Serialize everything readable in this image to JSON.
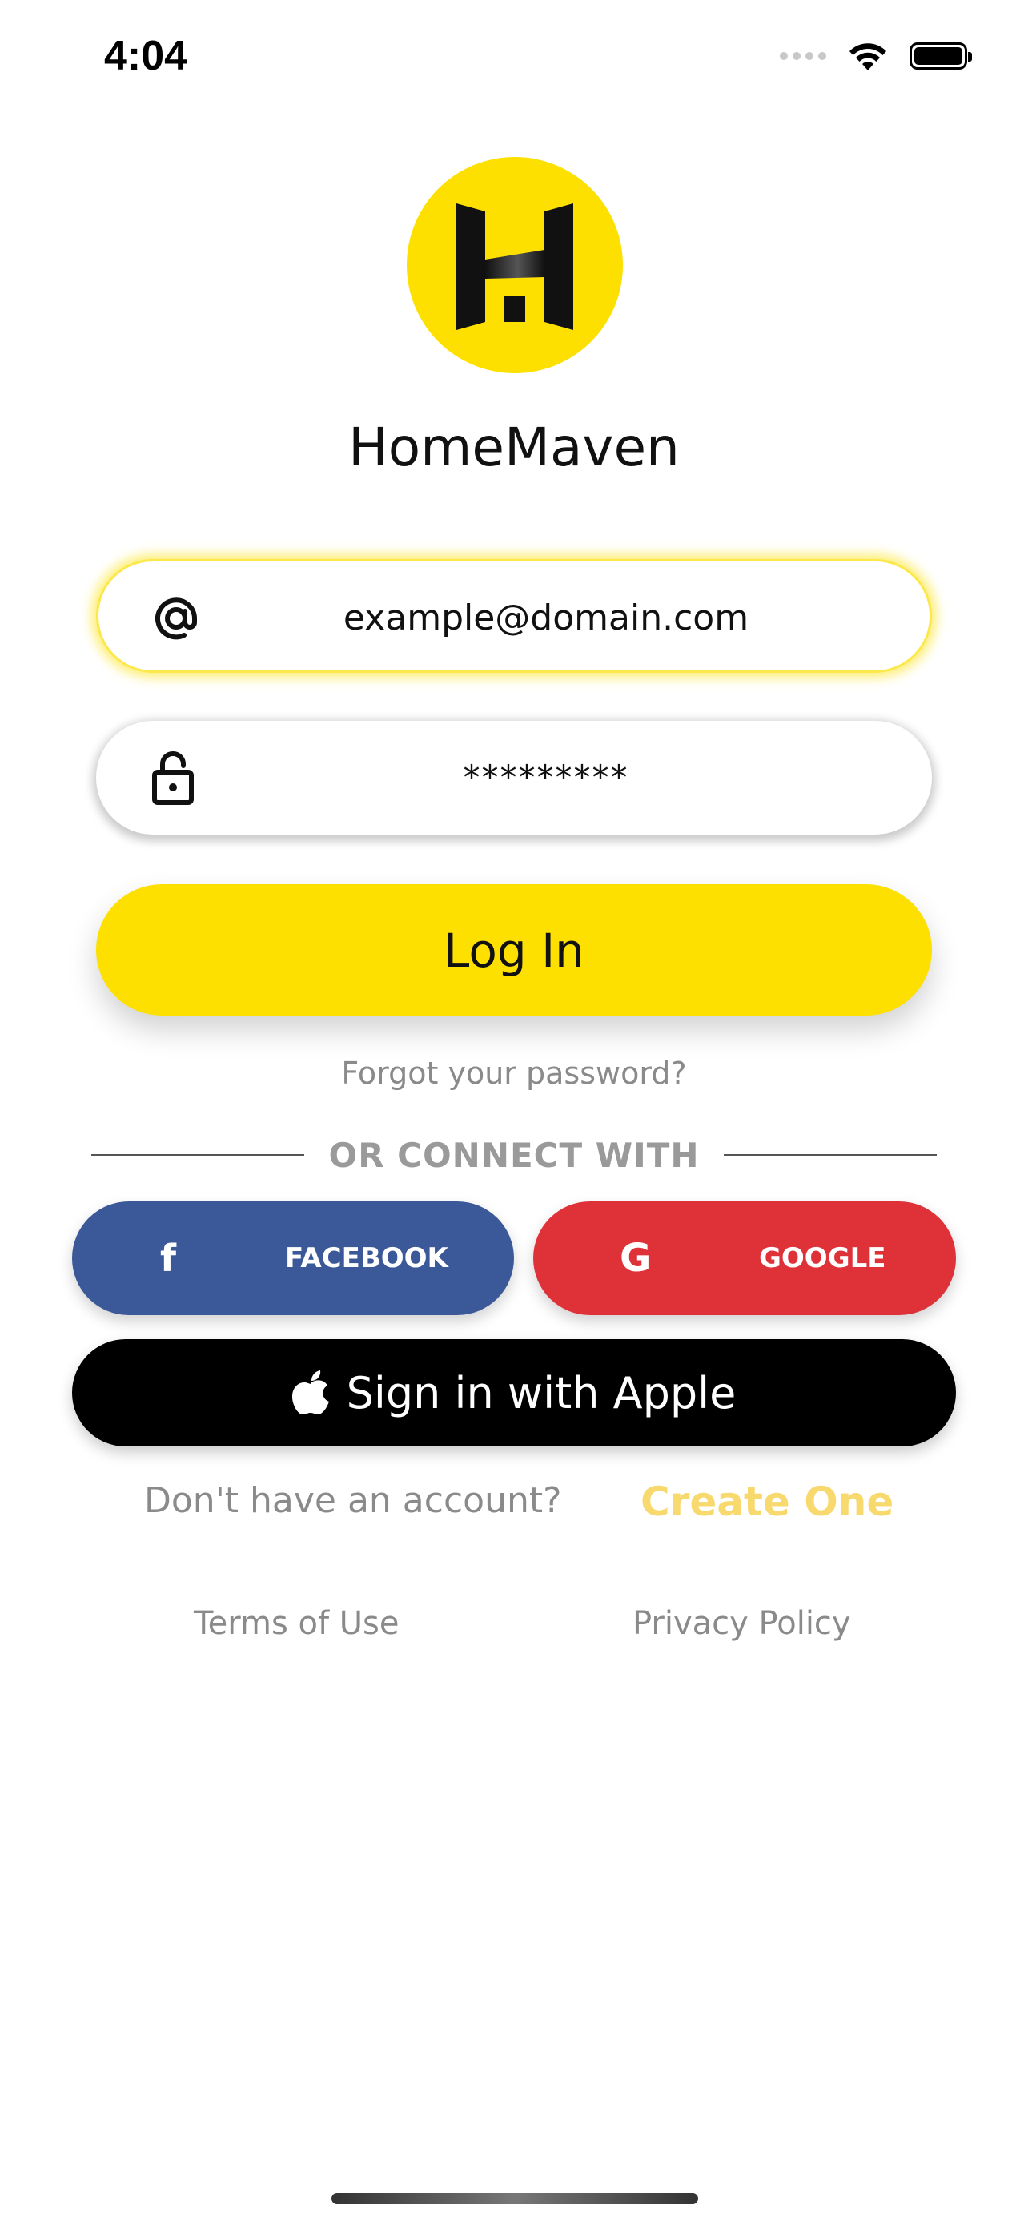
{
  "status_bar": {
    "time": "4:04"
  },
  "app": {
    "name": "HomeMaven",
    "brand_color": "#fde000"
  },
  "login_form": {
    "email": {
      "icon": "at-sign-icon",
      "value": "example@domain.com"
    },
    "password": {
      "icon": "unlock-icon",
      "value": "*********"
    },
    "login_label": "Log In",
    "forgot_label": "Forgot your password?"
  },
  "social": {
    "divider_label": "OR CONNECT WITH",
    "facebook": {
      "icon": "facebook-icon",
      "glyph": "f",
      "label": "FACEBOOK",
      "color": "#3b5998"
    },
    "google": {
      "icon": "google-icon",
      "glyph": "G",
      "label": "GOOGLE",
      "color": "#de3138"
    },
    "apple": {
      "icon": "apple-icon",
      "label": "Sign in with Apple",
      "color": "#000000"
    }
  },
  "signup": {
    "prompt": "Don't have an account?",
    "link_label": "Create One",
    "link_color": "#f8d96e"
  },
  "footer": {
    "terms_label": "Terms of Use",
    "privacy_label": "Privacy Policy"
  }
}
